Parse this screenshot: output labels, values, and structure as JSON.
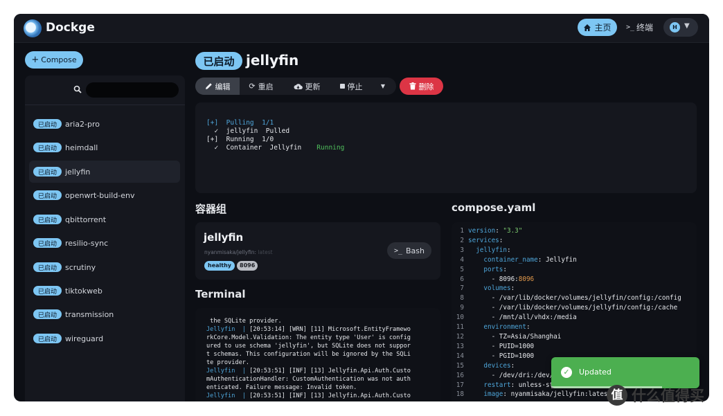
{
  "app": {
    "brand": "Dockge"
  },
  "topnav": {
    "home_label": "主页",
    "terminal_label": "终端",
    "profile_initial": "H"
  },
  "sidebar": {
    "compose_label": "Compose",
    "search_placeholder": "",
    "status_label": "已启动",
    "stacks": [
      "aria2-pro",
      "heimdall",
      "jellyfin",
      "openwrt-build-env",
      "qbittorrent",
      "resilio-sync",
      "scrutiny",
      "tiktokweb",
      "transmission",
      "wireguard"
    ],
    "active_stack": "jellyfin"
  },
  "main": {
    "status_badge": "已启动",
    "title": "jellyfin",
    "toolbar": {
      "edit": "编辑",
      "restart": "重启",
      "update": "更新",
      "stop": "停止",
      "delete": "删除"
    },
    "progress_lines": [
      "[+]  Pulling  1/1",
      "  ✓  jellyfin  Pulled",
      "[+]  Running  1/0",
      "  ✓  Container  Jellyfin",
      "Running"
    ],
    "containers_heading": "容器组",
    "container": {
      "name": "jellyfin",
      "image": "nyanmisaka/jellyfin:",
      "tag": "latest",
      "health": "healthy",
      "port": "8096",
      "bash_label": "Bash"
    },
    "terminal_heading": "Terminal",
    "log_lines": [
      " the SQLite provider.",
      "Jellyfin  | [20:53:14] [WRN] [11] Microsoft.EntityFramewo",
      "rkCore.Model.Validation: The entity type 'User' is config",
      "ured to use schema 'jellyfin', but SQLite does not suppor",
      "t schemas. This configuration will be ignored by the SQLi",
      "te provider.",
      "Jellyfin  | [20:53:51] [INF] [13] Jellyfin.Api.Auth.Custo",
      "mAuthenticationHandler: CustomAuthentication was not auth",
      "enticated. Failure message: Invalid token.",
      "Jellyfin  | [20:53:51] [INF] [13] Jellyfin.Api.Auth.Custo"
    ],
    "compose_heading": "compose.yaml",
    "compose_lines": [
      "version: \"3.3\"",
      "services:",
      "  jellyfin:",
      "    container_name: Jellyfin",
      "    ports:",
      "      - 8096:8096",
      "    volumes:",
      "      - /var/lib/docker/volumes/jellyfin/config:/config",
      "      - /var/lib/docker/volumes/jellyfin/config:/cache",
      "      - /mnt/all/vhdx:/media",
      "    environment:",
      "      - TZ=Asia/Shanghai",
      "      - PUID=1000",
      "      - PGID=1000",
      "    devices:",
      "      - /dev/dri:/dev/dri",
      "    restart: unless-stopped",
      "    image: nyanmisaka/jellyfin:latest"
    ]
  },
  "toast": {
    "message": "Updated"
  },
  "watermark": {
    "logo": "值",
    "text": "什么值得买"
  },
  "colors": {
    "accent": "#7dc6f3",
    "danger": "#dc3545",
    "success": "#4caf50",
    "bg": "#0d0f15"
  }
}
